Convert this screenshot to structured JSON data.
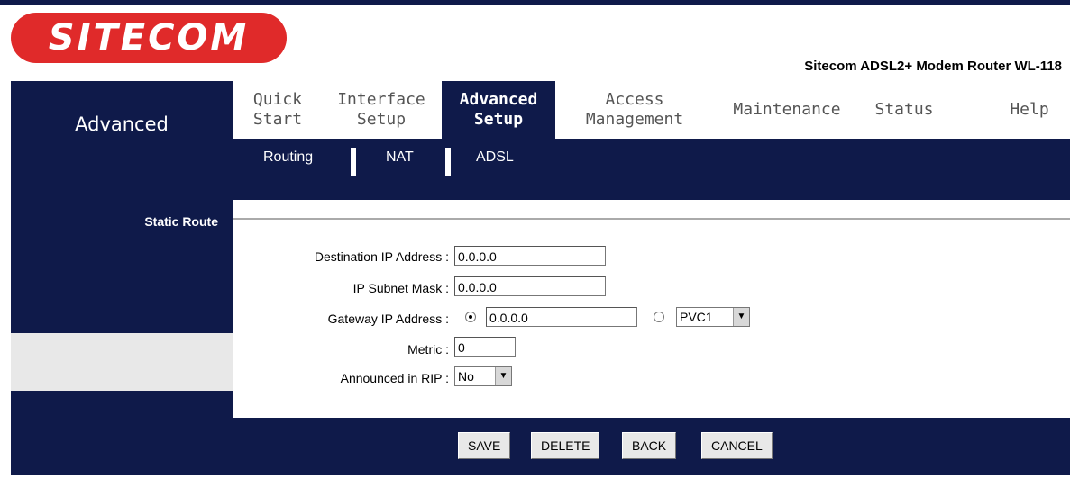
{
  "brand": {
    "logo_text": "SITECOM",
    "product": "Sitecom ADSL2+ Modem Router WL-118"
  },
  "sidebar": {
    "section_title": "Advanced",
    "subsection": "Static Route"
  },
  "tabs": [
    {
      "label": "Quick\nStart",
      "active": false
    },
    {
      "label": "Interface\nSetup",
      "active": false
    },
    {
      "label": "Advanced\nSetup",
      "active": true
    },
    {
      "label": "Access\nManagement",
      "active": false
    },
    {
      "label": "Maintenance",
      "active": false
    },
    {
      "label": "Status",
      "active": false
    },
    {
      "label": "Help",
      "active": false
    }
  ],
  "subtabs": [
    "Routing",
    "NAT",
    "ADSL"
  ],
  "form": {
    "dest_ip": {
      "label": "Destination IP Address :",
      "value": "0.0.0.0"
    },
    "subnet": {
      "label": "IP Subnet Mask :",
      "value": "0.0.0.0"
    },
    "gateway": {
      "label": "Gateway IP Address :",
      "value": "0.0.0.0",
      "pvc_value": "PVC1"
    },
    "metric": {
      "label": "Metric :",
      "value": "0"
    },
    "rip": {
      "label": "Announced in RIP :",
      "value": "No"
    }
  },
  "buttons": {
    "save": "SAVE",
    "delete": "DELETE",
    "back": "BACK",
    "cancel": "CANCEL"
  },
  "colors": {
    "navy": "#0f1a4a",
    "logo_red": "#e02a2a",
    "gray": "#e8e8e8"
  }
}
